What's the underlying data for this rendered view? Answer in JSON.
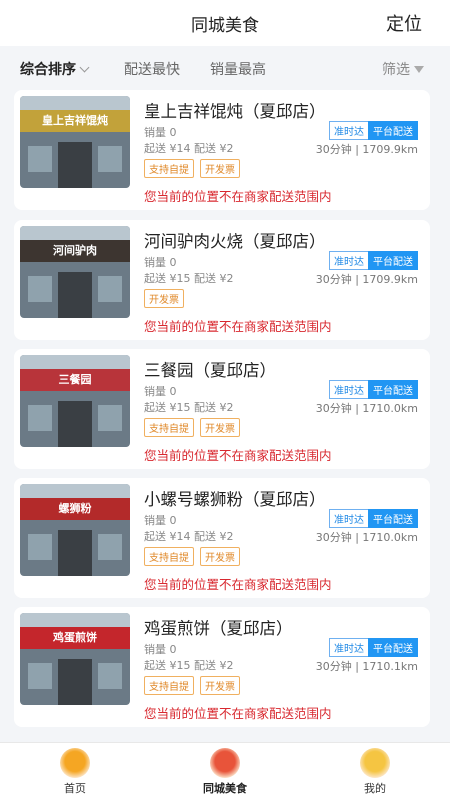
{
  "header": {
    "title": "同城美食",
    "locate": "定位"
  },
  "filters": {
    "sort": "综合排序",
    "fastest": "配送最快",
    "top_sales": "销量最高",
    "filter": "筛选"
  },
  "shops": [
    {
      "name": "皇上吉祥馄炖（夏邱店）",
      "sales": "销量 0",
      "price": "起送 ¥14   配送 ¥2",
      "tags": [
        "支持自提",
        "开发票"
      ],
      "badge1": "准时达",
      "badge2": "平台配送",
      "meta": "30分钟 |   1709.9km",
      "notice": "您当前的位置不在商家配送范围内",
      "sign": "皇上吉祥馄炖",
      "sign_color": "#c2a23a"
    },
    {
      "name": "河间驴肉火烧（夏邱店）",
      "sales": "销量 0",
      "price": "起送 ¥15   配送 ¥2",
      "tags": [
        "开发票"
      ],
      "badge1": "准时达",
      "badge2": "平台配送",
      "meta": "30分钟 |   1709.9km",
      "notice": "您当前的位置不在商家配送范围内",
      "sign": "河间驴肉",
      "sign_color": "#3d3530"
    },
    {
      "name": "三餐园（夏邱店）",
      "sales": "销量 0",
      "price": "起送 ¥15   配送 ¥2",
      "tags": [
        "支持自提",
        "开发票"
      ],
      "badge1": "准时达",
      "badge2": "平台配送",
      "meta": "30分钟 |   1710.0km",
      "notice": "您当前的位置不在商家配送范围内",
      "sign": "三餐园",
      "sign_color": "#b8343a"
    },
    {
      "name": "小螺号螺狮粉（夏邱店）",
      "sales": "销量 0",
      "price": "起送 ¥14   配送 ¥2",
      "tags": [
        "支持自提",
        "开发票"
      ],
      "badge1": "准时达",
      "badge2": "平台配送",
      "meta": "30分钟 |   1710.0km",
      "notice": "您当前的位置不在商家配送范围内",
      "sign": "螺狮粉",
      "sign_color": "#b32a2a"
    },
    {
      "name": "鸡蛋煎饼（夏邱店）",
      "sales": "销量 0",
      "price": "起送 ¥15   配送 ¥2",
      "tags": [
        "支持自提",
        "开发票"
      ],
      "badge1": "准时达",
      "badge2": "平台配送",
      "meta": "30分钟 |   1710.1km",
      "notice": "您当前的位置不在商家配送范围内",
      "sign": "鸡蛋煎饼",
      "sign_color": "#c4262c"
    }
  ],
  "tabbar": [
    {
      "label": "首页",
      "icon": "home-icon",
      "color": "#f5a623"
    },
    {
      "label": "同城美食",
      "icon": "food-icon",
      "color": "#e8543a"
    },
    {
      "label": "我的",
      "icon": "profile-icon",
      "color": "#f5c542"
    }
  ]
}
